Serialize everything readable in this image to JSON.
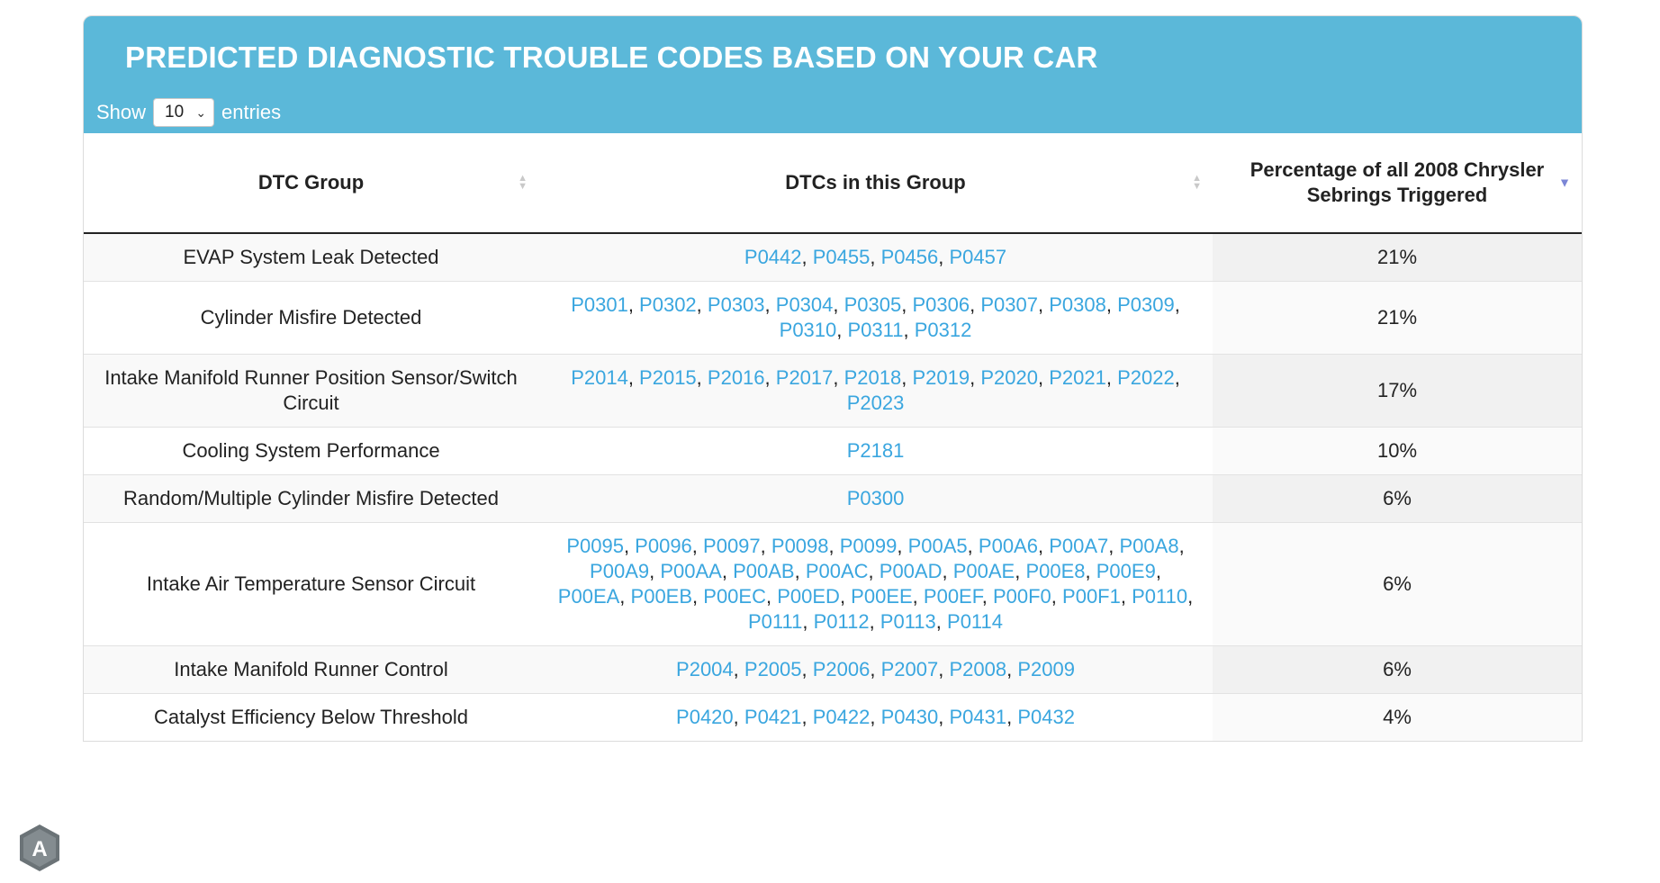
{
  "panel": {
    "title": "PREDICTED DIAGNOSTIC TROUBLE CODES BASED ON YOUR CAR",
    "length_prefix": "Show",
    "length_value": "10",
    "length_suffix": "entries"
  },
  "table": {
    "columns": [
      "DTC Group",
      "DTCs in this Group",
      "Percentage of all 2008 Chrysler Sebrings Triggered"
    ],
    "sort_column": "Percentage of all 2008 Chrysler Sebrings Triggered",
    "sort_direction": "descending",
    "rows": [
      {
        "group": "EVAP System Leak Detected",
        "codes": [
          "P0442",
          "P0455",
          "P0456",
          "P0457"
        ],
        "pct": "21%"
      },
      {
        "group": "Cylinder Misfire Detected",
        "codes": [
          "P0301",
          "P0302",
          "P0303",
          "P0304",
          "P0305",
          "P0306",
          "P0307",
          "P0308",
          "P0309",
          "P0310",
          "P0311",
          "P0312"
        ],
        "pct": "21%"
      },
      {
        "group": "Intake Manifold Runner Position Sensor/Switch Circuit",
        "codes": [
          "P2014",
          "P2015",
          "P2016",
          "P2017",
          "P2018",
          "P2019",
          "P2020",
          "P2021",
          "P2022",
          "P2023"
        ],
        "pct": "17%"
      },
      {
        "group": "Cooling System Performance",
        "codes": [
          "P2181"
        ],
        "pct": "10%"
      },
      {
        "group": "Random/Multiple Cylinder Misfire Detected",
        "codes": [
          "P0300"
        ],
        "pct": "6%"
      },
      {
        "group": "Intake Air Temperature Sensor Circuit",
        "codes": [
          "P0095",
          "P0096",
          "P0097",
          "P0098",
          "P0099",
          "P00A5",
          "P00A6",
          "P00A7",
          "P00A8",
          "P00A9",
          "P00AA",
          "P00AB",
          "P00AC",
          "P00AD",
          "P00AE",
          "P00E8",
          "P00E9",
          "P00EA",
          "P00EB",
          "P00EC",
          "P00ED",
          "P00EE",
          "P00EF",
          "P00F0",
          "P00F1",
          "P0110",
          "P0111",
          "P0112",
          "P0113",
          "P0114"
        ],
        "pct": "6%"
      },
      {
        "group": "Intake Manifold Runner Control",
        "codes": [
          "P2004",
          "P2005",
          "P2006",
          "P2007",
          "P2008",
          "P2009"
        ],
        "pct": "6%"
      },
      {
        "group": "Catalyst Efficiency Below Threshold",
        "codes": [
          "P0420",
          "P0421",
          "P0422",
          "P0430",
          "P0431",
          "P0432"
        ],
        "pct": "4%"
      }
    ]
  },
  "colors": {
    "header_bg": "#5bb8d9",
    "link": "#3aa6df",
    "sort_active": "#7b86d6"
  },
  "badge": {
    "letter": "A",
    "icon": "app-badge-icon"
  }
}
